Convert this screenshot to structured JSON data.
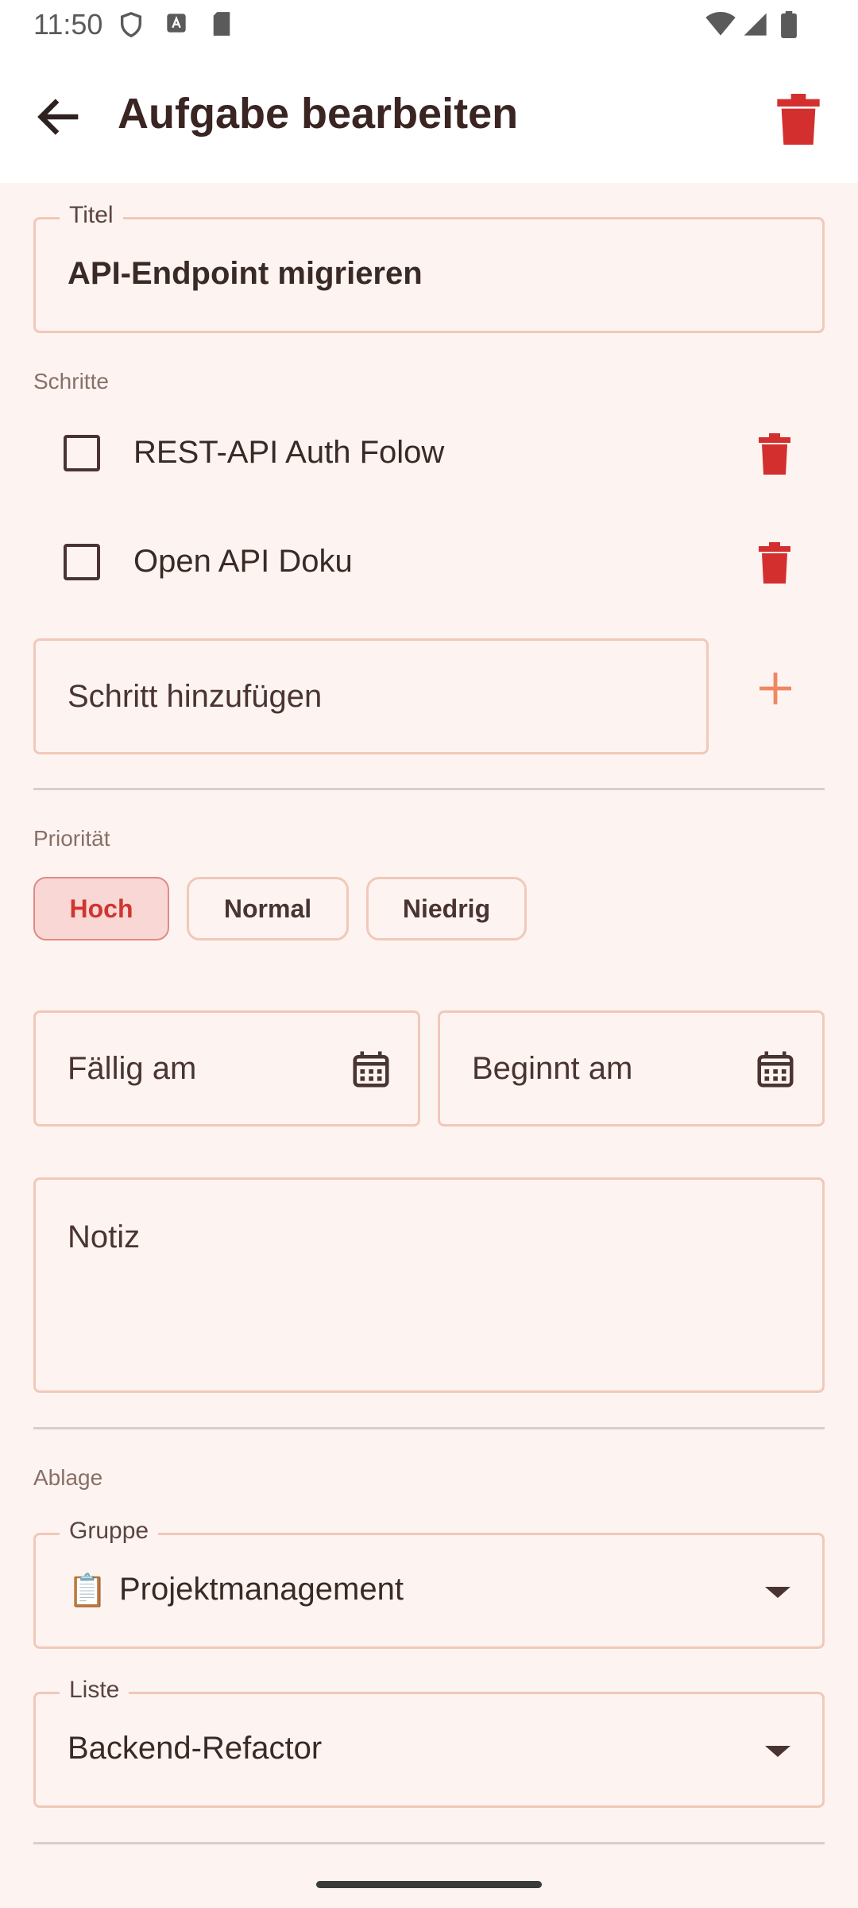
{
  "status_bar": {
    "time": "11:50"
  },
  "app_bar": {
    "title": "Aufgabe bearbeiten"
  },
  "title_field": {
    "label": "Titel",
    "value": "API-Endpoint migrieren"
  },
  "steps": {
    "section_label": "Schritte",
    "items": [
      {
        "label": "REST-API Auth Folow",
        "checked": false
      },
      {
        "label": "Open API Doku",
        "checked": false
      }
    ],
    "add_placeholder": "Schritt hinzufügen"
  },
  "priority": {
    "section_label": "Priorität",
    "options": [
      "Hoch",
      "Normal",
      "Niedrig"
    ],
    "selected": "Hoch"
  },
  "dates": {
    "due_placeholder": "Fällig am",
    "start_placeholder": "Beginnt am"
  },
  "note": {
    "placeholder": "Notiz"
  },
  "filing": {
    "section_label": "Ablage",
    "group": {
      "label": "Gruppe",
      "value": "Projektmanagement",
      "emoji": "📋"
    },
    "list": {
      "label": "Liste",
      "value": "Backend-Refactor"
    }
  },
  "colors": {
    "accent": "#D32F2F",
    "plus": "#F0875F",
    "background": "#FDF4F1"
  }
}
